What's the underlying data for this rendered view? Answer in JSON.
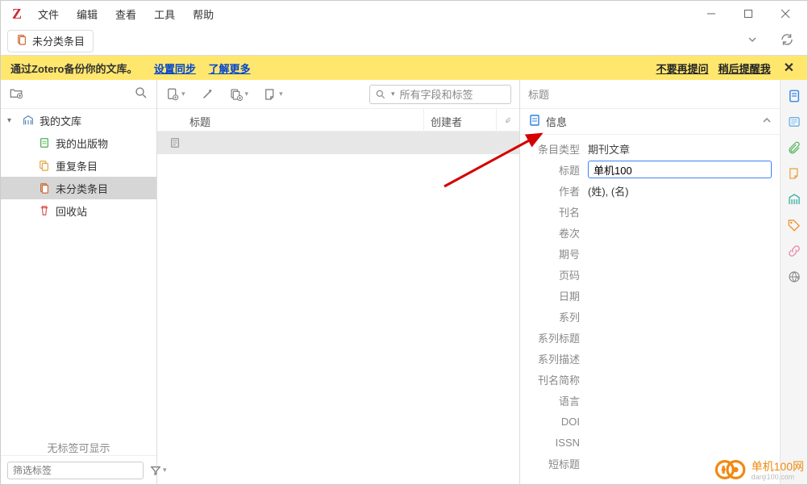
{
  "app": {
    "logo": "Z"
  },
  "menu": [
    "文件",
    "编辑",
    "查看",
    "工具",
    "帮助"
  ],
  "tab": {
    "label": "未分类条目"
  },
  "banner": {
    "text": "通过Zotero备份你的文库。",
    "link1": "设置同步",
    "link2": "了解更多",
    "dismiss1": "不要再提问",
    "dismiss2": "稍后提醒我"
  },
  "sidebar": {
    "root": "我的文库",
    "items": [
      {
        "label": "我的出版物"
      },
      {
        "label": "重复条目"
      },
      {
        "label": "未分类条目"
      },
      {
        "label": "回收站"
      }
    ],
    "empty": "无标签可显示",
    "filter_placeholder": "筛选标签"
  },
  "center": {
    "columns": {
      "title": "标题",
      "creator": "创建者"
    },
    "search_placeholder": "所有字段和标签"
  },
  "detail": {
    "title_header": "标题",
    "section": "信息",
    "fields": {
      "item_type_label": "条目类型",
      "item_type_value": "期刊文章",
      "title_label": "标题",
      "title_value": "单机100",
      "author_label": "作者",
      "author_value": "(姓), (名)",
      "journal_label": "刊名",
      "volume_label": "卷次",
      "issue_label": "期号",
      "pages_label": "页码",
      "date_label": "日期",
      "series_label": "系列",
      "series_title_label": "系列标题",
      "series_desc_label": "系列描述",
      "journal_abbr_label": "刊名简称",
      "language_label": "语言",
      "doi_label": "DOI",
      "issn_label": "ISSN",
      "short_title_label": "短标题"
    }
  },
  "watermark": {
    "name": "单机100网",
    "url": "danji100.com"
  }
}
